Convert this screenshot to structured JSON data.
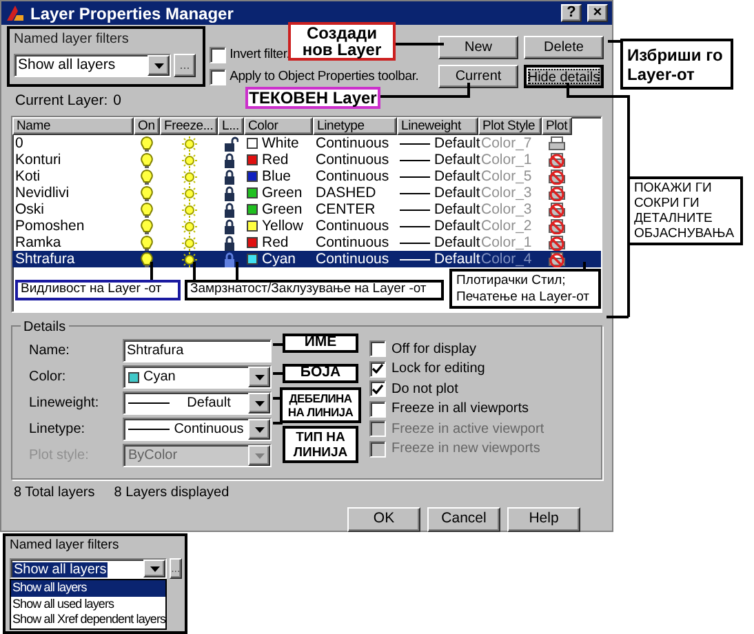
{
  "window": {
    "title": "Layer Properties Manager",
    "title_buttons": [
      "?",
      "×"
    ]
  },
  "filters": {
    "label": "Named layer filters",
    "value": "Show all layers",
    "more": "..."
  },
  "options": [
    {
      "label": "Invert filter.",
      "checked": false
    },
    {
      "label": "Apply to Object Properties toolbar.",
      "checked": false
    }
  ],
  "buttons": [
    {
      "label": "New",
      "focused": false
    },
    {
      "label": "Delete",
      "focused": false
    },
    {
      "label": "Current",
      "focused": false
    },
    {
      "label": "Hide details",
      "focused": true
    }
  ],
  "current_layer": {
    "label": "Current Layer:",
    "value": "0"
  },
  "table": {
    "columns": [
      "Name",
      "On",
      "Freeze...",
      "L...",
      "Color",
      "Linetype",
      "Lineweight",
      "Plot Style",
      "Plot"
    ],
    "rows": [
      {
        "name": "0",
        "on": true,
        "frozen": false,
        "locked": false,
        "color_name": "White",
        "color": "#ffffff",
        "linetype": "Continuous",
        "lineweight": "Default",
        "plot_style": "Color_7",
        "plot": true,
        "selected": false
      },
      {
        "name": "Konturi",
        "on": true,
        "frozen": false,
        "locked": true,
        "color_name": "Red",
        "color": "#e01010",
        "linetype": "Continuous",
        "lineweight": "Default",
        "plot_style": "Color_1",
        "plot": false,
        "selected": false
      },
      {
        "name": "Koti",
        "on": true,
        "frozen": false,
        "locked": true,
        "color_name": "Blue",
        "color": "#1020c0",
        "linetype": "Continuous",
        "lineweight": "Default",
        "plot_style": "Color_5",
        "plot": false,
        "selected": false
      },
      {
        "name": "Nevidlivi",
        "on": true,
        "frozen": false,
        "locked": true,
        "color_name": "Green",
        "color": "#20c020",
        "linetype": "DASHED",
        "lineweight": "Default",
        "plot_style": "Color_3",
        "plot": false,
        "selected": false
      },
      {
        "name": "Oski",
        "on": true,
        "frozen": false,
        "locked": true,
        "color_name": "Green",
        "color": "#20c020",
        "linetype": "CENTER",
        "lineweight": "Default",
        "plot_style": "Color_3",
        "plot": false,
        "selected": false
      },
      {
        "name": "Pomoshen",
        "on": true,
        "frozen": false,
        "locked": true,
        "color_name": "Yellow",
        "color": "#ffff40",
        "linetype": "Continuous",
        "lineweight": "Default",
        "plot_style": "Color_2",
        "plot": false,
        "selected": false
      },
      {
        "name": "Ramka",
        "on": true,
        "frozen": false,
        "locked": true,
        "color_name": "Red",
        "color": "#e01010",
        "linetype": "Continuous",
        "lineweight": "Default",
        "plot_style": "Color_1",
        "plot": false,
        "selected": false
      },
      {
        "name": "Shtrafura",
        "on": true,
        "frozen": false,
        "locked": true,
        "color_name": "Cyan",
        "color": "#40e0f0",
        "linetype": "Continuous",
        "lineweight": "Default",
        "plot_style": "Color_4",
        "plot": false,
        "selected": true
      }
    ]
  },
  "details": {
    "title": "Details",
    "fields": [
      {
        "label": "Name:",
        "kind": "text",
        "value": "Shtrafura",
        "disabled": false
      },
      {
        "label": "Color:",
        "kind": "color",
        "value": "Cyan",
        "color": "#40c8c8",
        "disabled": false
      },
      {
        "label": "Lineweight:",
        "kind": "line",
        "value": "Default",
        "disabled": false
      },
      {
        "label": "Linetype:",
        "kind": "line",
        "value": "Continuous",
        "disabled": false
      },
      {
        "label": "Plot style:",
        "kind": "combo",
        "value": "ByColor",
        "disabled": true
      }
    ],
    "checks": [
      {
        "label": "Off for display",
        "checked": false,
        "disabled": false
      },
      {
        "label": "Lock for editing",
        "checked": true,
        "disabled": false
      },
      {
        "label": "Do not plot",
        "checked": true,
        "disabled": false
      },
      {
        "label": "Freeze in all viewports",
        "checked": false,
        "disabled": false
      },
      {
        "label": "Freeze in active viewport",
        "checked": false,
        "disabled": true
      },
      {
        "label": "Freeze in new viewports",
        "checked": false,
        "disabled": true
      }
    ]
  },
  "status": [
    "8 Total layers",
    "8 Layers displayed"
  ],
  "footer_buttons": [
    "OK",
    "Cancel",
    "Help"
  ],
  "annotations": [
    {
      "text": "Создади нов Layer",
      "color": "#cc2020"
    },
    {
      "text": "Избриши го Layer-от",
      "color": "#000000"
    },
    {
      "text": "ТЕКОВЕН Layer",
      "color": "#cc30cc"
    },
    {
      "text": "ПОКАЖИ ГИ СОКРИ ГИ ДЕТАЛНИТЕ ОБЈАСНУВАЊА",
      "color": "#000000"
    },
    {
      "text": "Видливост на Layer -от",
      "color": "#1a1aa0"
    },
    {
      "text": "Замрзнатост/Заклузување на Layer -от",
      "color": "#000000"
    },
    {
      "text": "Плотирачки Стил; Печатење на Layer-от",
      "color": "#000000"
    },
    {
      "text": "ИМЕ",
      "color": "#000000"
    },
    {
      "text": "БОЈА",
      "color": "#000000"
    },
    {
      "text": "ДЕБЕЛИНА НА ЛИНИЈА",
      "color": "#000000"
    },
    {
      "text": "ТИП НА ЛИНИЈА",
      "color": "#000000"
    }
  ],
  "filter_dropdown": {
    "label": "Named layer filters",
    "value": "Show all layers",
    "more": "...",
    "options": [
      {
        "label": "Show all layers",
        "selected": true
      },
      {
        "label": "Show all used layers",
        "selected": false
      },
      {
        "label": "Show all Xref dependent layers",
        "selected": false
      }
    ]
  }
}
